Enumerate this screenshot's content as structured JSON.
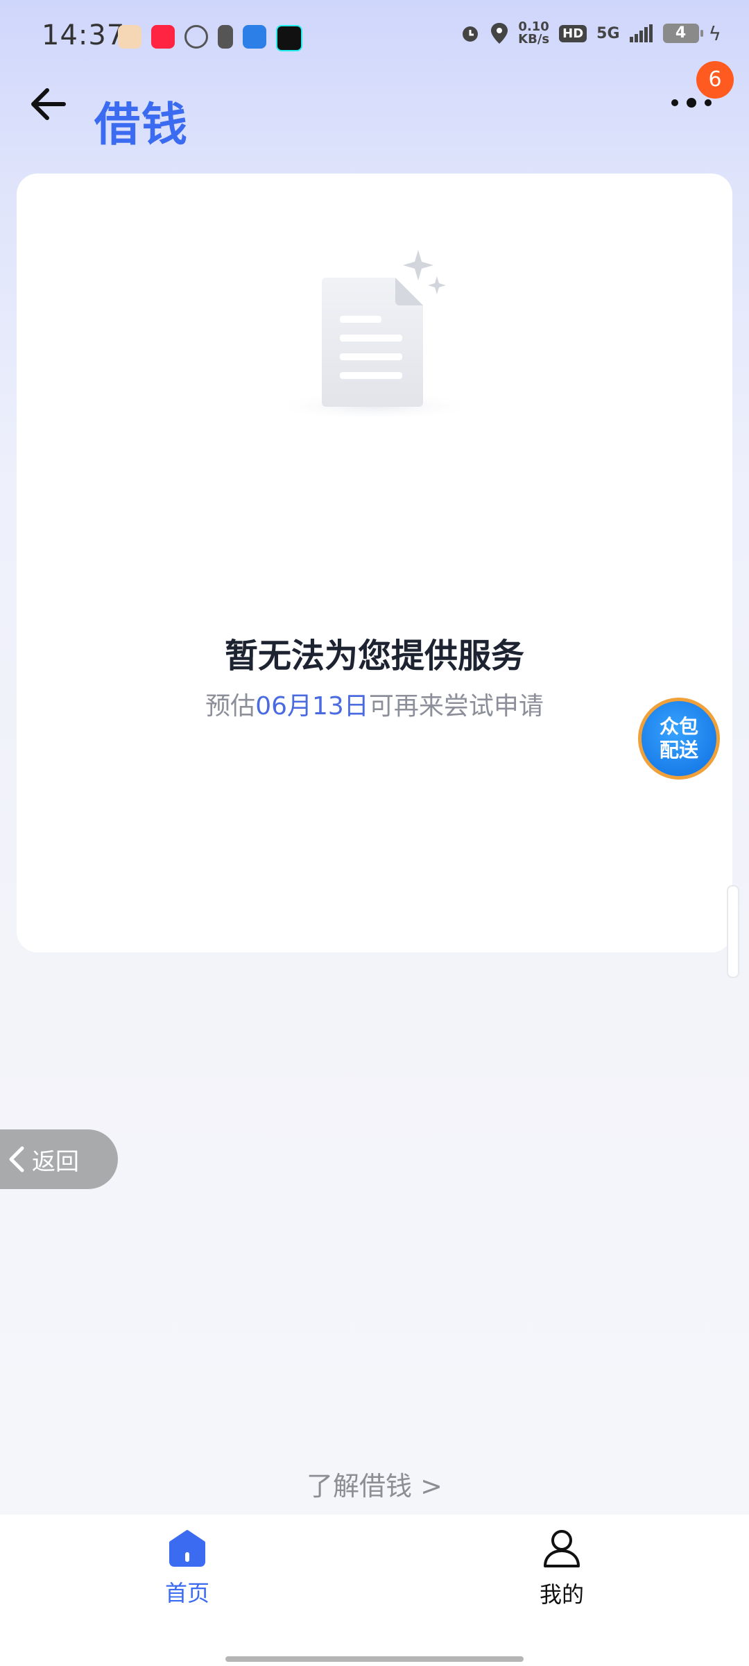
{
  "status_bar": {
    "time": "14:37",
    "net_speed_value": "0.10",
    "net_speed_unit": "KB/s",
    "hd": "HD",
    "signal": "5G",
    "battery": "4"
  },
  "header": {
    "title": "借钱",
    "badge_count": "6"
  },
  "empty_state": {
    "title": "暂无法为您提供服务",
    "sub_prefix": "预估",
    "sub_date": "06月13日",
    "sub_suffix": "可再来尝试申请"
  },
  "floating_bubble": {
    "line1": "众包",
    "line2": "配送"
  },
  "return_pill": {
    "label": "返回"
  },
  "learn_link": {
    "label": "了解借钱 >"
  },
  "bottom_nav": {
    "tabs": [
      {
        "label": "首页",
        "icon": "home-icon",
        "active": true
      },
      {
        "label": "我的",
        "icon": "user-icon",
        "active": false
      }
    ]
  },
  "colors": {
    "accent": "#3b6bf0",
    "badge": "#ff5a1f",
    "bubble": "#1a7ff0"
  }
}
